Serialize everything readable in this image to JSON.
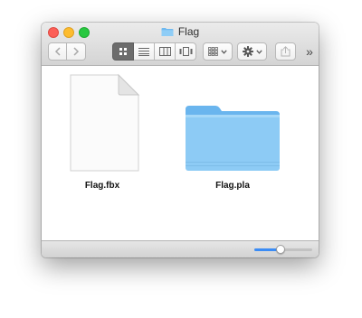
{
  "window": {
    "title": "Flag",
    "title_icon": "folder-icon"
  },
  "toolbar": {
    "back_icon": "chevron-left-icon",
    "forward_icon": "chevron-right-icon",
    "view_modes": [
      {
        "name": "icon-view",
        "active": true
      },
      {
        "name": "list-view",
        "active": false
      },
      {
        "name": "column-view",
        "active": false
      },
      {
        "name": "cover-flow-view",
        "active": false
      }
    ],
    "arrange_icon": "arrange-grid-icon",
    "action_icon": "gear-icon",
    "share_icon": "share-icon",
    "overflow_label": "»"
  },
  "files": [
    {
      "name": "Flag.fbx",
      "kind": "document",
      "icon": "document-icon"
    },
    {
      "name": "Flag.pla",
      "kind": "folder",
      "icon": "folder-icon"
    }
  ],
  "statusbar": {
    "icon_size_slider": 0.45
  },
  "colors": {
    "close": "#fc5f57",
    "minimize": "#fdbc2e",
    "zoom": "#28c840",
    "folder": "#7ec3f3",
    "slider_accent": "#3b8cf5"
  }
}
